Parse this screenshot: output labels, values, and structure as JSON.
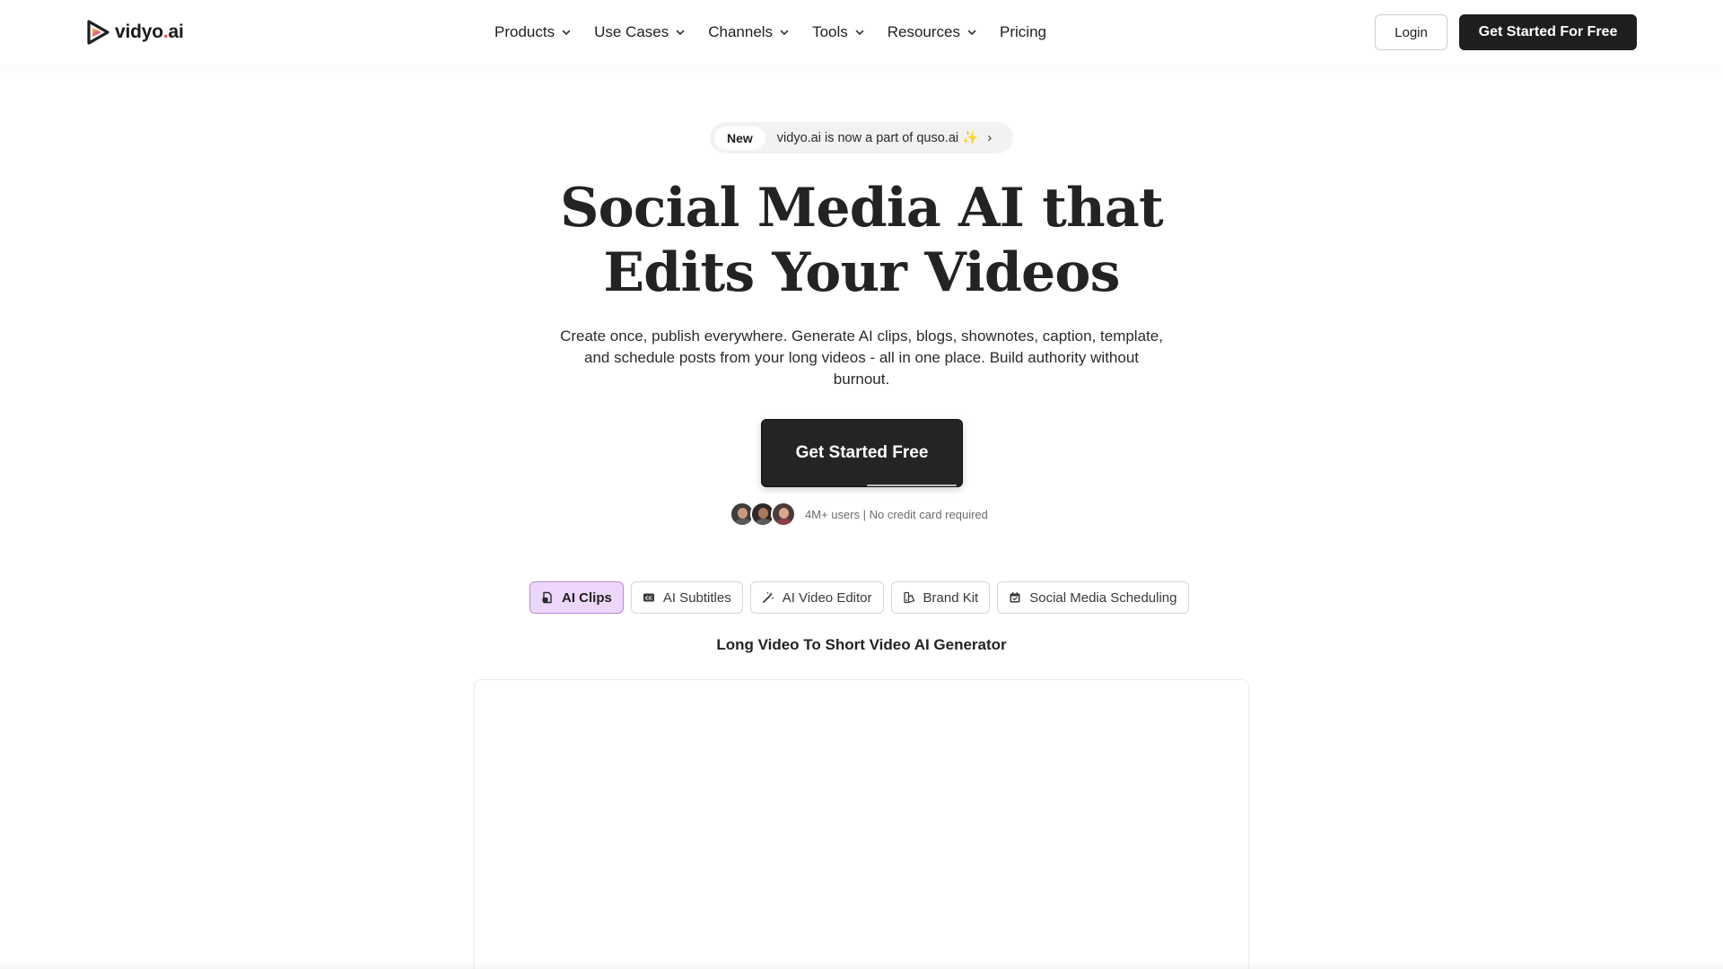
{
  "brand": {
    "logo_icon": "play-triangle-logo-icon",
    "name_left": "vidyo",
    "name_dot": ".",
    "name_right": "ai",
    "colors": {
      "dark": "#1e1e1e",
      "accent_pink": "#e5484d",
      "accent_yellow": "#f5c84b",
      "tab_active_bg": "#ecd7fb",
      "tab_active_border": "#b98ad9"
    }
  },
  "nav": {
    "items": [
      {
        "label": "Products",
        "has_dropdown": true
      },
      {
        "label": "Use Cases",
        "has_dropdown": true
      },
      {
        "label": "Channels",
        "has_dropdown": true
      },
      {
        "label": "Tools",
        "has_dropdown": true
      },
      {
        "label": "Resources",
        "has_dropdown": true
      },
      {
        "label": "Pricing",
        "has_dropdown": false
      }
    ],
    "login_label": "Login",
    "cta_label": "Get Started For Free"
  },
  "announcement": {
    "badge": "New",
    "text": "vidyo.ai is now a part of quso.ai ✨",
    "arrow": "›"
  },
  "hero": {
    "title_line1": "Social Media AI that",
    "title_line2": "Edits Your Videos",
    "subtitle": "Create once, publish everywhere. Generate AI clips, blogs, shownotes, caption, template, and schedule posts from your long videos - all in one place. Build authority without burnout.",
    "cta_label": "Get Started Free",
    "proof_text": "4M+ users | No credit card required"
  },
  "features": {
    "tabs": [
      {
        "label": "AI Clips",
        "icon": "clip-file-icon",
        "active": true
      },
      {
        "label": "AI Subtitles",
        "icon": "cc-subtitles-icon",
        "active": false
      },
      {
        "label": "AI Video Editor",
        "icon": "magic-wand-icon",
        "active": false
      },
      {
        "label": "Brand Kit",
        "icon": "brand-kit-icon",
        "active": false
      },
      {
        "label": "Social Media Scheduling",
        "icon": "calendar-icon",
        "active": false
      }
    ],
    "heading": "Long Video To Short Video AI Generator"
  }
}
